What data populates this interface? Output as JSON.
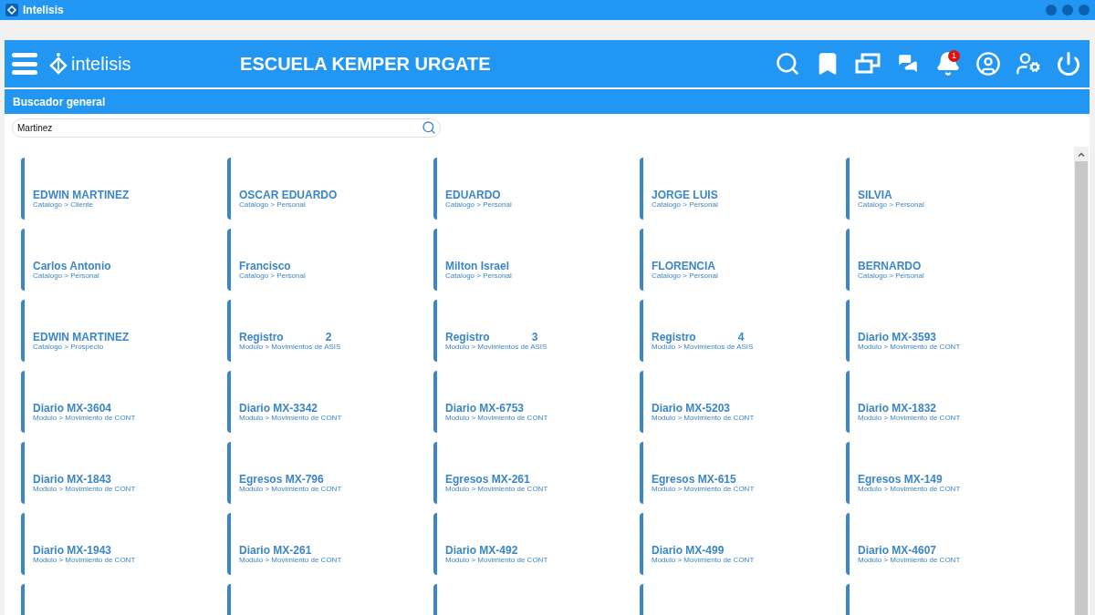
{
  "window": {
    "title": "Intelisis"
  },
  "header": {
    "logo": "intelisis",
    "title": "ESCUELA KEMPER URGATE",
    "notification_count": "1"
  },
  "panel": {
    "title": "Buscador general"
  },
  "search": {
    "value": "Martinez"
  },
  "results": [
    {
      "kind": "entry",
      "title": "EDWIN MARTINEZ",
      "path": "Catalogo > Cliente"
    },
    {
      "kind": "entry",
      "title": "OSCAR EDUARDO",
      "path": "Catalogo > Personal"
    },
    {
      "kind": "entry",
      "title": "EDUARDO",
      "path": "Catalogo > Personal"
    },
    {
      "kind": "entry",
      "title": "JORGE LUIS",
      "path": "Catalogo > Personal"
    },
    {
      "kind": "entry",
      "title": "SILVIA",
      "path": "Catalogo > Personal"
    },
    {
      "kind": "entry",
      "title": "Carlos Antonio",
      "path": "Catalogo > Personal"
    },
    {
      "kind": "entry",
      "title": "Francisco",
      "path": "Catalogo > Personal"
    },
    {
      "kind": "entry",
      "title": "Milton Israel",
      "path": "Catalogo > Personal"
    },
    {
      "kind": "entry",
      "title": "FLORENCIA",
      "path": "Catalogo > Personal"
    },
    {
      "kind": "entry",
      "title": "BERNARDO",
      "path": "Catalogo > Personal"
    },
    {
      "kind": "entry",
      "title": "EDWIN MARTINEZ",
      "path": "Catalogo > Prospecto"
    },
    {
      "kind": "entry",
      "title": "Registro",
      "number": "2",
      "path": "Modulo > Movimientos de ASIS"
    },
    {
      "kind": "entry",
      "title": "Registro",
      "number": "3",
      "path": "Modulo > Movimientos de ASIS"
    },
    {
      "kind": "entry",
      "title": "Registro",
      "number": "4",
      "path": "Modulo > Movimientos de ASIS"
    },
    {
      "kind": "entry",
      "title": "Diario MX-3593",
      "path": "Modulo > Movimiento de CONT"
    },
    {
      "kind": "entry",
      "title": "Diario MX-3604",
      "path": "Modulo > Movimiento de CONT"
    },
    {
      "kind": "entry",
      "title": "Diario MX-3342",
      "path": "Modulo > Movimiento de CONT"
    },
    {
      "kind": "entry",
      "title": "Diario MX-6753",
      "path": "Modulo > Movimiento de CONT"
    },
    {
      "kind": "entry",
      "title": "Diario MX-5203",
      "path": "Modulo > Movimiento de CONT"
    },
    {
      "kind": "entry",
      "title": "Diario MX-1832",
      "path": "Modulo > Movimiento de CONT"
    },
    {
      "kind": "entry",
      "title": "Diario MX-1843",
      "path": "Modulo > Movimiento de CONT"
    },
    {
      "kind": "entry",
      "title": "Egresos MX-796",
      "path": "Modulo > Movimiento de CONT"
    },
    {
      "kind": "entry",
      "title": "Egresos MX-261",
      "path": "Modulo > Movimiento de CONT"
    },
    {
      "kind": "entry",
      "title": "Egresos MX-615",
      "path": "Modulo > Movimiento de CONT"
    },
    {
      "kind": "entry",
      "title": "Egresos MX-149",
      "path": "Modulo > Movimiento de CONT"
    },
    {
      "kind": "entry",
      "title": "Diario MX-1943",
      "path": "Modulo > Movimiento de CONT"
    },
    {
      "kind": "entry",
      "title": "Diario MX-261",
      "path": "Modulo > Movimiento de CONT"
    },
    {
      "kind": "entry",
      "title": "Diario MX-492",
      "path": "Modulo > Movimiento de CONT"
    },
    {
      "kind": "entry",
      "title": "Diario MX-499",
      "path": "Modulo > Movimiento de CONT"
    },
    {
      "kind": "entry",
      "title": "Diario MX-4607",
      "path": "Modulo > Movimiento de CONT"
    },
    {
      "kind": "cut"
    },
    {
      "kind": "cut"
    },
    {
      "kind": "cut"
    },
    {
      "kind": "cut"
    },
    {
      "kind": "cut"
    }
  ]
}
